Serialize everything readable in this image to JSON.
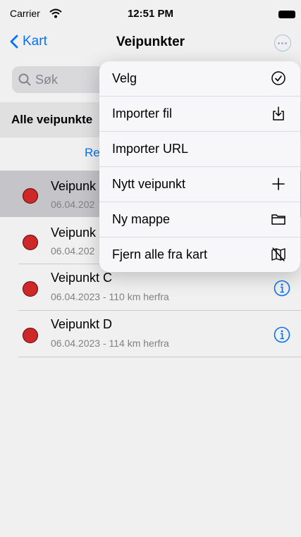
{
  "status_bar": {
    "carrier": "Carrier",
    "time": "12:51 PM"
  },
  "nav": {
    "back_label": "Kart",
    "title": "Veipunkter"
  },
  "search": {
    "placeholder": "Søk"
  },
  "section": {
    "title": "Alle veipunkte",
    "action_label": "Re"
  },
  "waypoints": [
    {
      "name": "Veipunk",
      "subtitle": "06.04.202",
      "selected": true
    },
    {
      "name": "Veipunk",
      "subtitle": "06.04.202",
      "selected": false
    },
    {
      "name": "Veipunkt C",
      "subtitle": "06.04.2023 - 110 km herfra",
      "selected": false
    },
    {
      "name": "Veipunkt D",
      "subtitle": "06.04.2023 - 114 km herfra",
      "selected": false
    }
  ],
  "menu": {
    "items": [
      {
        "label": "Velg",
        "icon": "checkmark-circle-icon"
      },
      {
        "label": "Importer fil",
        "icon": "import-file-icon"
      },
      {
        "label": "Importer URL",
        "icon": ""
      },
      {
        "label": "Nytt veipunkt",
        "icon": "plus-icon"
      },
      {
        "label": "Ny mappe",
        "icon": "folder-icon"
      },
      {
        "label": "Fjern alle fra kart",
        "icon": "map-slash-icon"
      }
    ]
  },
  "colors": {
    "accent": "#0a7aff",
    "waypoint_dot": "#db2b2b",
    "selected_row": "#d1d1d6"
  }
}
